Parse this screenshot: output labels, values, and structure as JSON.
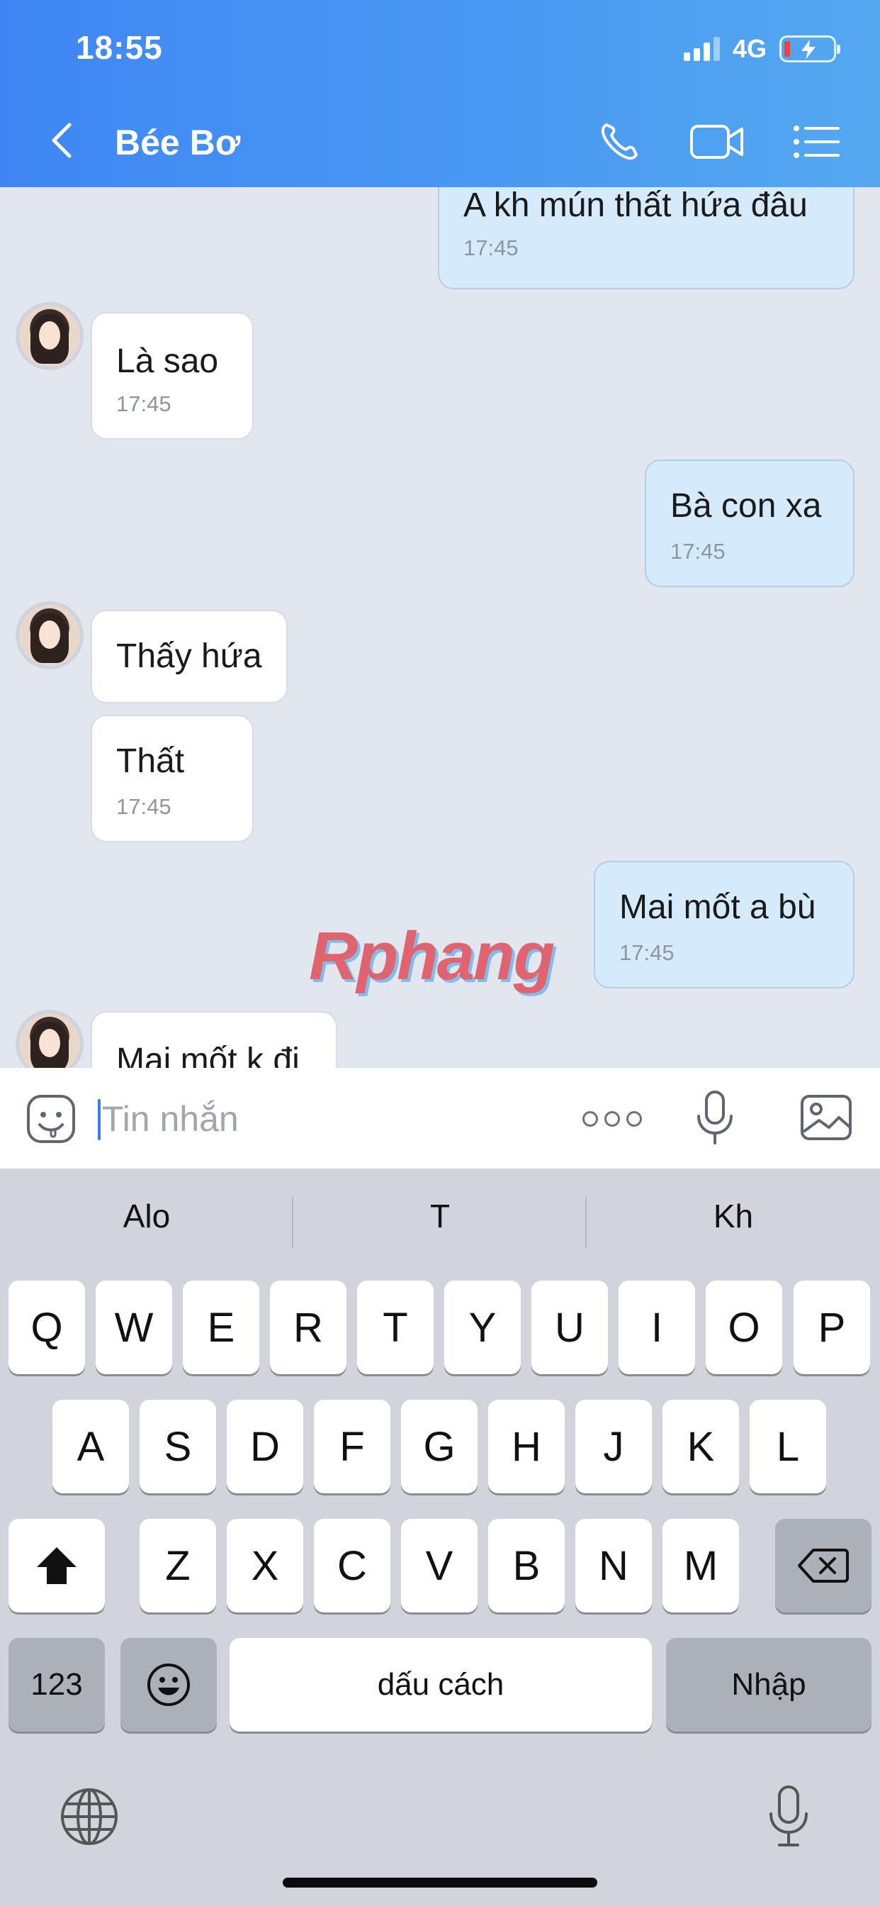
{
  "status_bar": {
    "time": "18:55",
    "network": "4G"
  },
  "header": {
    "contact_name": "Bée Bơ"
  },
  "messages": [
    {
      "side": "out",
      "text": "A kh mún thất hứa đâu",
      "time": "17:45"
    },
    {
      "side": "in",
      "text": "Là sao",
      "time": "17:45"
    },
    {
      "side": "out",
      "text": "Bà con xa",
      "time": "17:45"
    },
    {
      "side": "in",
      "text": "Thấy hứa",
      "time": ""
    },
    {
      "side": "in",
      "text": "Thất",
      "time": "17:45"
    },
    {
      "side": "out",
      "text": "Mai mốt a bù",
      "time": "17:45"
    },
    {
      "side": "in",
      "text": "Mai mốt k đi",
      "time": ""
    }
  ],
  "watermark": "Rphang",
  "composer": {
    "placeholder": "Tin nhắn"
  },
  "keyboard": {
    "suggestions": [
      "Alo",
      "T",
      "Kh"
    ],
    "row1": [
      "Q",
      "W",
      "E",
      "R",
      "T",
      "Y",
      "U",
      "I",
      "O",
      "P"
    ],
    "row2": [
      "A",
      "S",
      "D",
      "F",
      "G",
      "H",
      "J",
      "K",
      "L"
    ],
    "row3": [
      "Z",
      "X",
      "C",
      "V",
      "B",
      "N",
      "M"
    ],
    "numbers_key": "123",
    "space_key": "dấu cách",
    "return_key": "Nhập"
  },
  "colors": {
    "header_start": "#3f86f4",
    "header_end": "#54a8f0",
    "outgoing_bubble": "#d5ebfb",
    "incoming_bubble": "#ffffff"
  }
}
